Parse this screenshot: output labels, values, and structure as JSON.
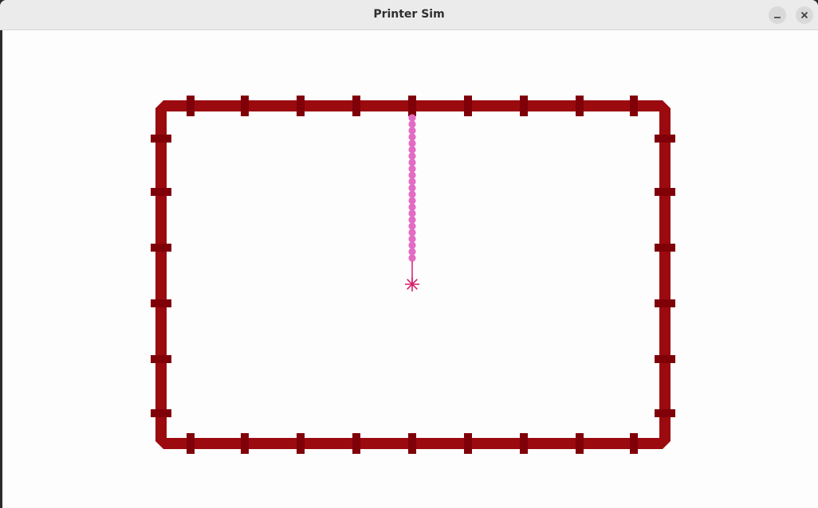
{
  "window": {
    "title": "Printer Sim",
    "minimize_icon": "minimize-icon",
    "close_icon": "close-icon"
  },
  "colors": {
    "frame": "#9b0a0f",
    "frame_tab": "#7f0008",
    "path": "#e36bc3",
    "head": "#d61f6a",
    "titlebar": "#ebebeb",
    "canvas": "#fdfdfd"
  },
  "simulation": {
    "printed_dot_count": 23,
    "head_icon": "asterisk-crosshair-icon"
  }
}
